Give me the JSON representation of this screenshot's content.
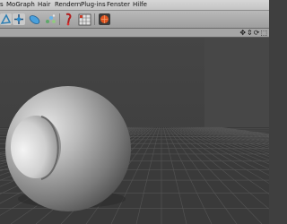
{
  "menu": [
    "s",
    "MoGraph",
    "Hair",
    "Rendern",
    "Plug-ins",
    "Fenster",
    "Hilfe"
  ],
  "toolbar": {
    "tools": [
      "polygon-pen-icon",
      "move-tool-icon",
      "capsule-icon",
      "particles-icon",
      "brush-icon",
      "keyframe-grid-icon",
      "render-icon"
    ]
  },
  "viewport": {
    "nav_icons": [
      "✥",
      "⇕",
      "⟳",
      "⬚"
    ],
    "colors": {
      "floor": "#3a3a3a",
      "grid": "#575757",
      "sky": "#414141",
      "sphere": "#9a9a9a"
    }
  }
}
